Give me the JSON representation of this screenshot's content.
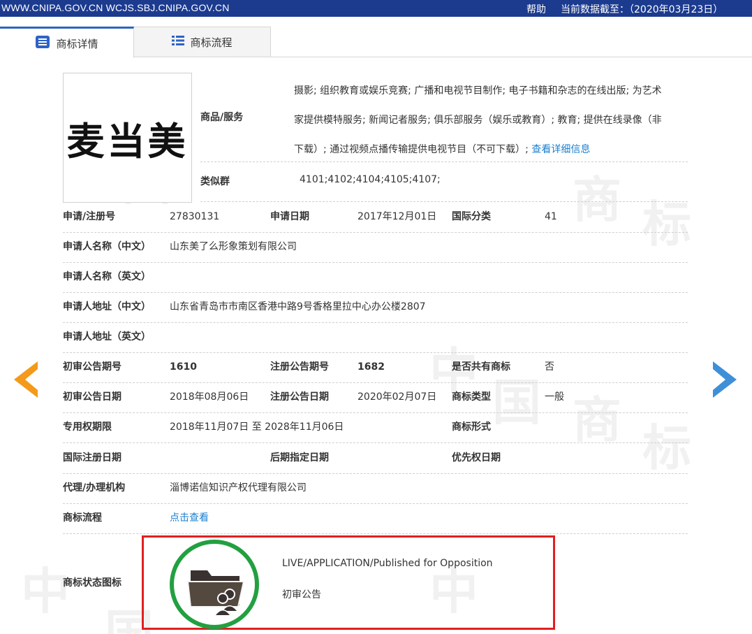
{
  "topbar": {
    "site": "WWW.CNIPA.GOV.CN WCJS.SBJ.CNIPA.GOV.CN",
    "help": "帮助",
    "data_date": "当前数据截至：（2020年03月23日）"
  },
  "tabs": [
    {
      "label": "商标详情"
    },
    {
      "label": "商标流程"
    }
  ],
  "mark_text": "麦当美",
  "goods_services": {
    "label": "商品/服务",
    "line1": "摄影; 组织教育或娱乐竞赛; 广播和电视节目制作; 电子书籍和杂志的在线出版; 为艺术",
    "line2": "家提供模特服务; 新闻记者服务; 俱乐部服务（娱乐或教育）; 教育; 提供在线录像（非",
    "line3": "下载）; 通过视频点播传输提供电视节目（不可下载）; ",
    "link": "查看详细信息"
  },
  "similar_group": {
    "label": "类似群",
    "value": "4101;4102;4104;4105;4107;"
  },
  "fields": {
    "reg_no_label": "申请/注册号",
    "reg_no": "27830131",
    "apply_date_label": "申请日期",
    "apply_date": "2017年12月01日",
    "intl_class_label": "国际分类",
    "intl_class": "41",
    "applicant_cn_label": "申请人名称（中文）",
    "applicant_cn": "山东美了么形象策划有限公司",
    "applicant_en_label": "申请人名称（英文）",
    "addr_cn_label": "申请人地址（中文）",
    "addr_cn": "山东省青岛市市南区香港中路9号香格里拉中心办公楼2807",
    "addr_en_label": "申请人地址（英文）",
    "prelim_no_label": "初审公告期号",
    "prelim_no": "1610",
    "reg_pub_no_label": "注册公告期号",
    "reg_pub_no": "1682",
    "shared_label": "是否共有商标",
    "shared": "否",
    "prelim_date_label": "初审公告日期",
    "prelim_date": "2018年08月06日",
    "reg_pub_date_label": "注册公告日期",
    "reg_pub_date": "2020年02月07日",
    "mark_type_label": "商标类型",
    "mark_type": "一般",
    "exclusive_label": "专用权期限",
    "exclusive": "2018年11月07日 至 2028年11月06日",
    "mark_form_label": "商标形式",
    "intl_reg_date_label": "国际注册日期",
    "later_date_label": "后期指定日期",
    "priority_date_label": "优先权日期",
    "agent_label": "代理/办理机构",
    "agent": "淄博诺信知识产权代理有限公司",
    "flow_label": "商标流程",
    "flow_link": "点击查看"
  },
  "status": {
    "label": "商标状态图标",
    "en": "LIVE/APPLICATION/Published for Opposition",
    "cn": "初审公告"
  },
  "watermarks": [
    "中",
    "国",
    "商",
    "标"
  ],
  "colors": {
    "topbar": "#1c3b8f",
    "link": "#1a7fd0",
    "status_ring": "#22a040",
    "status_box": "#e02020",
    "prev_arrow": "#f39a1a",
    "next_arrow": "#3f8fd8"
  }
}
